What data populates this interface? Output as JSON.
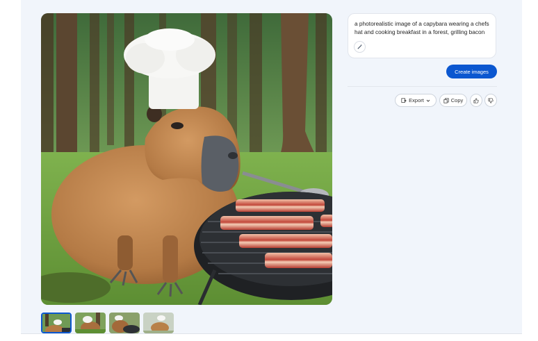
{
  "prompt": {
    "text": "a photorealistic image of a capybara wearing a chefs hat and cooking breakfast in a forest, grilling bacon",
    "edit_icon": "magic-wand-icon"
  },
  "create_button": {
    "label": "Create images",
    "color": "#0b57d0"
  },
  "actions": {
    "export_label": "Export",
    "export_icon": "export-icon",
    "copy_label": "Copy",
    "copy_icon": "copy-icon",
    "like_icon": "thumbs-up-icon",
    "dislike_icon": "thumbs-down-icon"
  },
  "gallery": {
    "main_image": "capybara-chef-grilling-bacon",
    "thumbnails": [
      {
        "name": "capybara-chef-1",
        "selected": true
      },
      {
        "name": "capybara-chef-2",
        "selected": false
      },
      {
        "name": "capybara-chef-3",
        "selected": false
      },
      {
        "name": "capybara-chef-4",
        "selected": false
      }
    ]
  },
  "colors": {
    "panel_bg": "#f1f5fb",
    "accent": "#0b57d0"
  }
}
